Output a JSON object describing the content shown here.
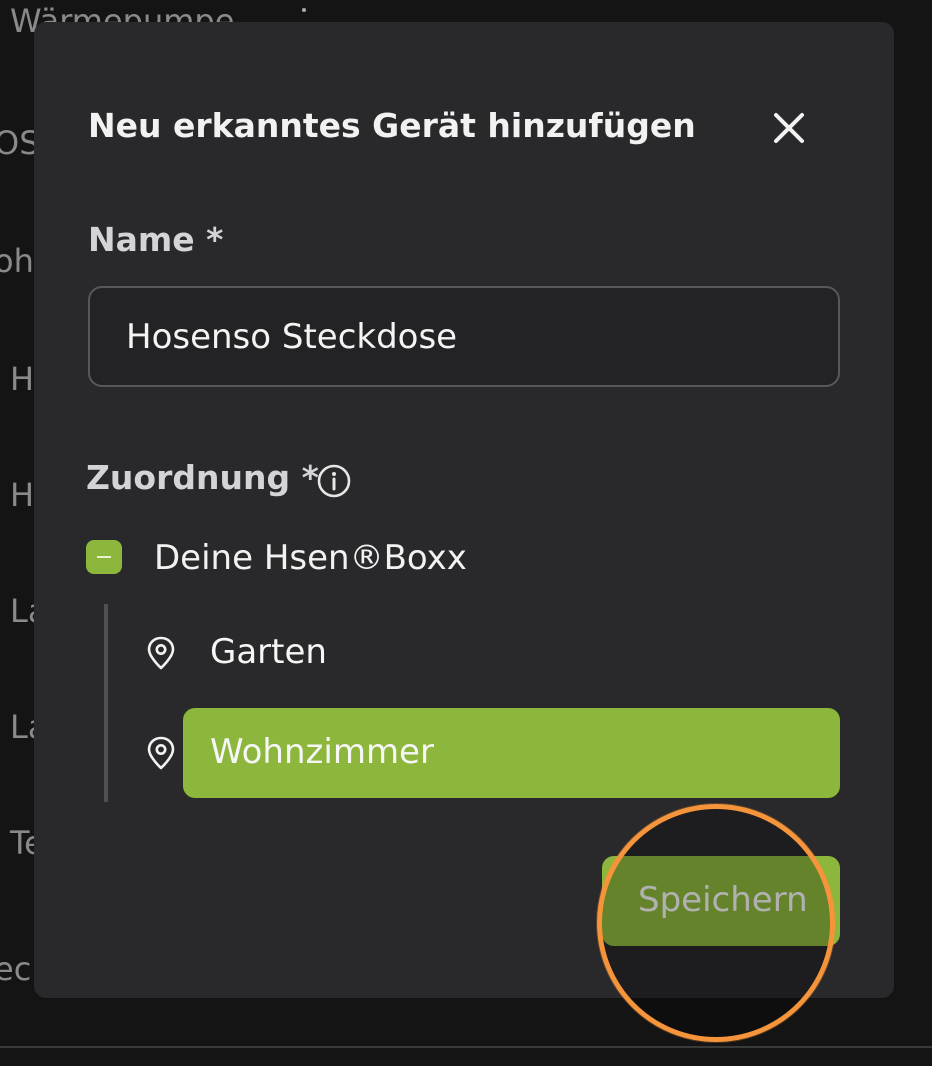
{
  "background": {
    "fragments": [
      "Wärmepumpe",
      "OSE",
      "ohn",
      "H",
      "H",
      "La",
      "La",
      "Te",
      "ec"
    ]
  },
  "dialog": {
    "title": "Neu erkanntes Gerät hinzufügen",
    "close_icon": "close-icon"
  },
  "name_field": {
    "label": "Name *",
    "value": "Hosenso Steckdose"
  },
  "assignment": {
    "label": "Zuordnung *",
    "info_icon": "info-icon",
    "root": {
      "label": "Deine Hsen®Boxx",
      "state": "indeterminate"
    },
    "rooms": [
      {
        "label": "Garten",
        "selected": false,
        "icon": "location-pin-icon"
      },
      {
        "label": "Wohnzimmer",
        "selected": true,
        "icon": "location-pin-icon"
      }
    ]
  },
  "actions": {
    "save_label": "Speichern"
  },
  "colors": {
    "dialog_bg": "#29292b",
    "accent_green": "#8db63c",
    "highlight_orange": "#f5943a",
    "page_bg": "#141414"
  }
}
